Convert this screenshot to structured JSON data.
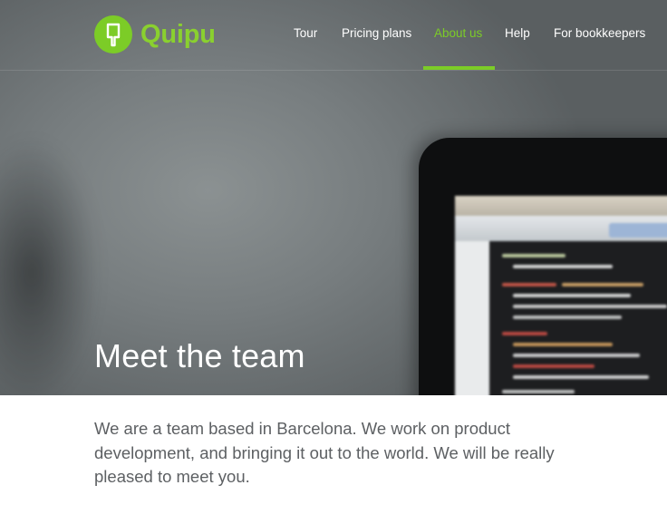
{
  "brand": {
    "name": "Quipu",
    "accent": "#7ccc27"
  },
  "nav": {
    "items": [
      {
        "label": "Tour",
        "active": false
      },
      {
        "label": "Pricing plans",
        "active": false
      },
      {
        "label": "About us",
        "active": true
      },
      {
        "label": "Help",
        "active": false
      },
      {
        "label": "For bookkeepers",
        "active": false
      }
    ]
  },
  "hero": {
    "title": "Meet the team"
  },
  "intro": {
    "text": "We are a team based in Barcelona. We work on product development, and bringing it out to the world. We will be really pleased to meet you."
  }
}
